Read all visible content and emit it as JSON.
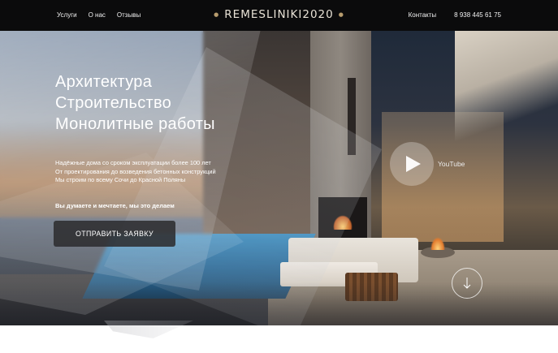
{
  "header": {
    "nav_left": [
      "Услуги",
      "О нас",
      "Отзывы"
    ],
    "brand": "REMESLINIKI2020",
    "nav_right": {
      "contacts": "Контакты",
      "phone": "8 938 445 61 75"
    }
  },
  "hero": {
    "headline": [
      "Архитектура",
      "Строительство",
      "Монолитные работы"
    ],
    "description": [
      "Надёжные дома со сроком эксплуатации более 100 лет",
      "От проектирования до возведения бетонных конструкций",
      "Мы строим по всему Сочи до Красной Поляны"
    ],
    "tagline": "Вы думаете и мечтаете, мы это делаем",
    "cta_label": "ОТПРАВИТЬ ЗАЯВКУ",
    "video_label": "YouTube"
  },
  "icons": {
    "play": "play-icon",
    "scroll": "arrow-down-icon"
  },
  "colors": {
    "topbar_bg": "#0b0b0c",
    "brand_accent": "#b79c6e",
    "cta_bg": "#2d2d30"
  }
}
